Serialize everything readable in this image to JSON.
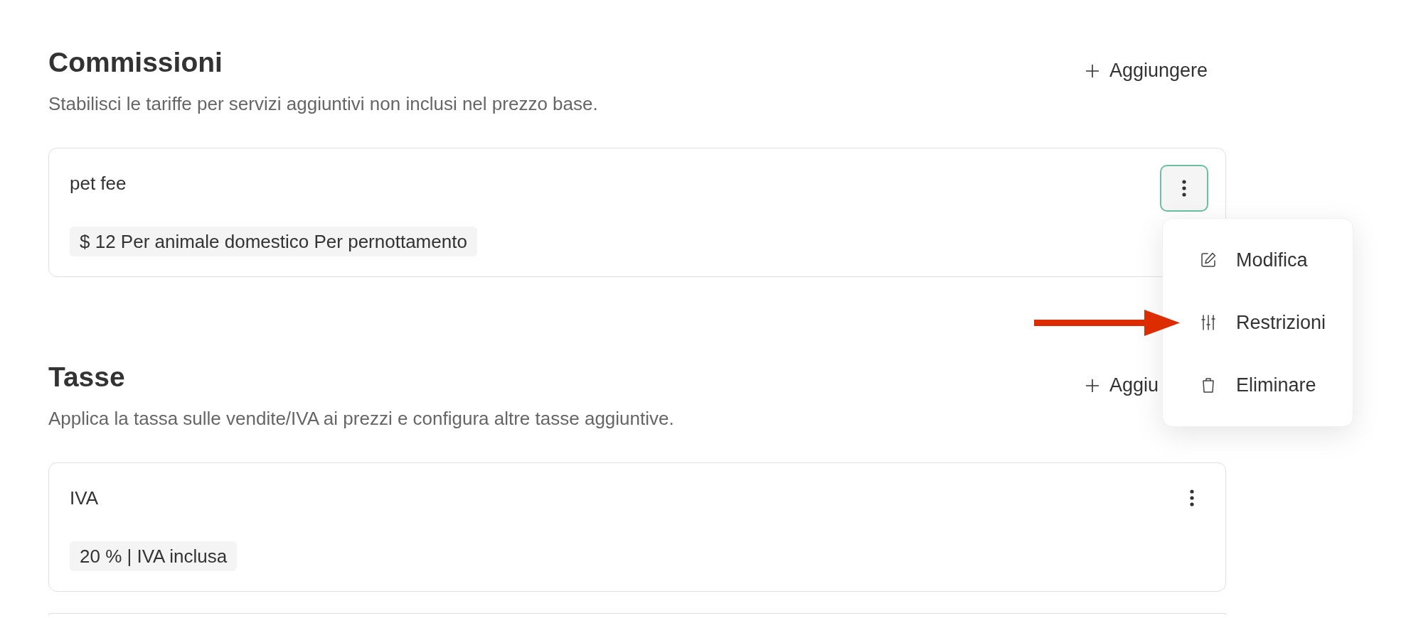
{
  "sections": [
    {
      "title": "Commissioni",
      "description": "Stabilisci le tariffe per servizi aggiuntivi non inclusi nel prezzo base.",
      "add_button": "Aggiungere",
      "cards": [
        {
          "name": "pet fee",
          "tag": "$ 12 Per animale domestico Per pernottamento",
          "menu_open": true
        }
      ],
      "partial_card": false
    },
    {
      "title": "Tasse",
      "description": "Applica la tassa sulle vendite/IVA ai prezzi e configura altre tasse aggiuntive.",
      "add_button": "Aggiu",
      "cards": [
        {
          "name": "IVA",
          "tag": "20 % | IVA inclusa",
          "menu_open": false
        }
      ],
      "partial_card": true
    }
  ],
  "menu": {
    "items": [
      {
        "kind": "edit",
        "label": "Modifica"
      },
      {
        "kind": "restrictions",
        "label": "Restrizioni"
      },
      {
        "kind": "delete",
        "label": "Eliminare"
      }
    ]
  }
}
